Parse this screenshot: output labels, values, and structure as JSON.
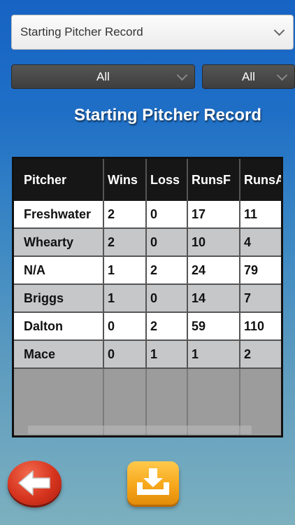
{
  "report_select": {
    "value": "Starting Pitcher Record"
  },
  "filters": {
    "filter_1": "All",
    "filter_2": "All"
  },
  "page_title": "Starting Pitcher Record",
  "table": {
    "columns": [
      "Pitcher",
      "Wins",
      "Loss",
      "RunsF",
      "RunsA"
    ],
    "rows": [
      [
        "Freshwater",
        "2",
        "0",
        "17",
        "11"
      ],
      [
        "Whearty",
        "2",
        "0",
        "10",
        "4"
      ],
      [
        "N/A",
        "1",
        "2",
        "24",
        "79"
      ],
      [
        "Briggs",
        "1",
        "0",
        "14",
        "7"
      ],
      [
        "Dalton",
        "0",
        "2",
        "59",
        "110"
      ],
      [
        "Mace",
        "0",
        "1",
        "1",
        "2"
      ]
    ]
  },
  "icons": {
    "back": "arrow-left-icon",
    "export": "download-tray-icon"
  },
  "colors": {
    "back_button": "#d6341e",
    "export_button": "#f7a81c",
    "header_bg": "#161616"
  }
}
